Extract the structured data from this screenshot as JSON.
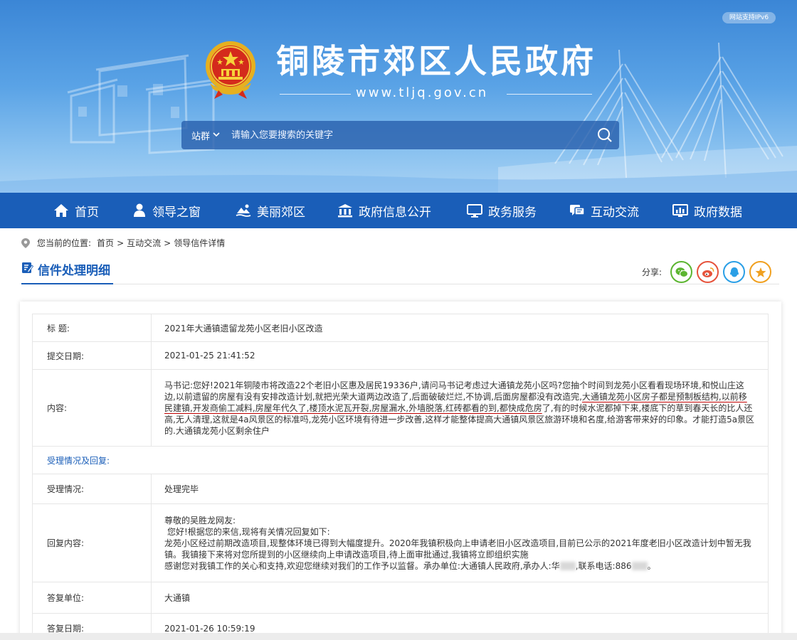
{
  "header": {
    "ipv6_badge": "网站支持IPv6",
    "site_title": "铜陵市郊区人民政府",
    "site_url": "www.tljq.gov.cn",
    "search": {
      "site_group_label": "站群",
      "placeholder": "请输入您要搜索的关键字"
    }
  },
  "nav": {
    "items": [
      {
        "label": "首页",
        "icon": "home-icon"
      },
      {
        "label": "领导之窗",
        "icon": "person-icon"
      },
      {
        "label": "美丽郊区",
        "icon": "scenery-icon"
      },
      {
        "label": "政府信息公开",
        "icon": "government-building-icon"
      },
      {
        "label": "政务服务",
        "icon": "monitor-icon"
      },
      {
        "label": "互动交流",
        "icon": "chat-icon"
      },
      {
        "label": "政府数据",
        "icon": "data-chart-icon"
      }
    ]
  },
  "breadcrumb": {
    "prefix": "您当前的位置:",
    "items": [
      "首页",
      "互动交流",
      "领导信件详情"
    ],
    "separator": ">"
  },
  "section": {
    "title": "信件处理明细"
  },
  "share": {
    "label": "分享:",
    "buttons": [
      {
        "name": "wechat-share-button",
        "icon": "wechat-icon",
        "color": "#5cb531"
      },
      {
        "name": "weibo-share-button",
        "icon": "weibo-icon",
        "color": "#e6533c"
      },
      {
        "name": "qq-share-button",
        "icon": "qq-icon",
        "color": "#2a9fe6"
      },
      {
        "name": "favorite-share-button",
        "icon": "star-icon",
        "color": "#f0a020"
      }
    ]
  },
  "letter": {
    "title_label": "标  题:",
    "title": "2021年大通镇遗留龙苑小区老旧小区改造",
    "submit_date_label": "提交日期:",
    "submit_date": "2021-01-25 21:41:52",
    "content_label": "内容:",
    "content_part1": "马书记:您好!2021年铜陵市将改造22个老旧小区惠及居民19336户,请问马书记考虑过大通镇龙苑小区吗?您抽个时间到龙苑小区看看现场环境,和悦山庄这边,以前遗留的房屋有没有安排改造计划,就把光荣大道两边改造了,后面破破烂烂,不协调,后面房屋都没有改造完,",
    "content_underlined": "大通镇龙苑小区房子都是预制板结构,以前移民建镇,开发商偷工减料,房屋年代久了,楼顶水泥瓦开裂,房屋漏水,外墙脱落,红砖都看的到,都快成危房",
    "content_part2": "了,有的时候水泥都掉下来,楼底下的草到春天长的比人还高,无人清理,这就是4a风景区的标准吗,龙苑小区环境有待进一步改善,这样才能整体提高大通镇风景区旅游环境和名度,给游客带来好的印象。才能打造5a景区的.大通镇龙苑小区剩余住户"
  },
  "reply": {
    "section_label": "受理情况及回复:",
    "status_label": "受理情况:",
    "status": "处理完毕",
    "content_label": "回复内容:",
    "greeting": "尊敬的吴胜龙网友:",
    "line1": "您好!根据您的来信,现将有关情况回复如下:",
    "line2": "龙苑小区经过前期改造项目,现整体环境已得到大幅度提升。2020年我镇积极向上申请老旧小区改造项目,目前已公示的2021年度老旧小区改造计划中暂无我镇。我镇接下来将对您所提到的小区继续向上申请改造项目,待上面审批通过,我镇将立即组织实施",
    "line3_a": "感谢您对我镇工作的关心和支持,欢迎您继续对我们的工作予以监督。承办单位:大通镇人民政府,承办人:华",
    "line3_b": ",联系电话:886",
    "line3_end": "。",
    "unit_label": "答复单位:",
    "unit": "大通镇",
    "date_label": "答复日期:",
    "date": "2021-01-26 10:59:19"
  },
  "colors": {
    "nav_bg": "#1a5eb8",
    "accent": "#1a5eb8",
    "underline": "#c00000"
  }
}
